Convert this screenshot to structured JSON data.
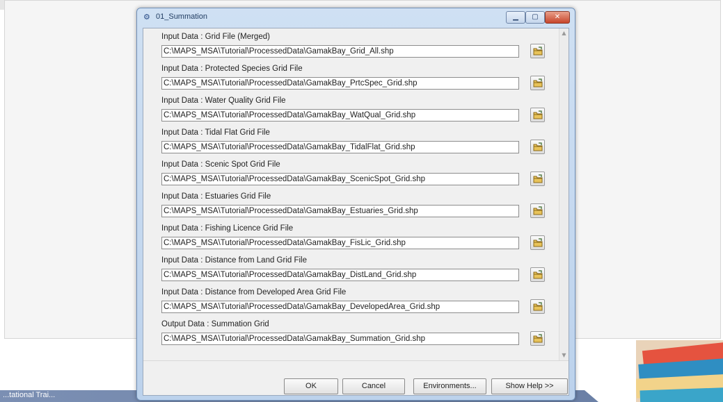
{
  "dialog": {
    "title": "01_Summation",
    "params": [
      {
        "label": "Input Data : Grid File (Merged)",
        "value": "C:\\MAPS_MSA\\Tutorial\\ProcessedData\\GamakBay_Grid_All.shp"
      },
      {
        "label": "Input Data : Protected Species Grid File",
        "value": "C:\\MAPS_MSA\\Tutorial\\ProcessedData\\GamakBay_PrtcSpec_Grid.shp"
      },
      {
        "label": "Input Data : Water Quality Grid File",
        "value": "C:\\MAPS_MSA\\Tutorial\\ProcessedData\\GamakBay_WatQual_Grid.shp"
      },
      {
        "label": "Input Data : Tidal Flat Grid File",
        "value": "C:\\MAPS_MSA\\Tutorial\\ProcessedData\\GamakBay_TidalFlat_Grid.shp"
      },
      {
        "label": "Input Data : Scenic Spot Grid File",
        "value": "C:\\MAPS_MSA\\Tutorial\\ProcessedData\\GamakBay_ScenicSpot_Grid.shp"
      },
      {
        "label": "Input Data : Estuaries Grid File",
        "value": "C:\\MAPS_MSA\\Tutorial\\ProcessedData\\GamakBay_Estuaries_Grid.shp"
      },
      {
        "label": "Input Data : Fishing Licence Grid File",
        "value": "C:\\MAPS_MSA\\Tutorial\\ProcessedData\\GamakBay_FisLic_Grid.shp"
      },
      {
        "label": "Input Data : Distance from Land Grid File",
        "value": "C:\\MAPS_MSA\\Tutorial\\ProcessedData\\GamakBay_DistLand_Grid.shp"
      },
      {
        "label": "Input Data : Distance from Developed Area Grid File",
        "value": "C:\\MAPS_MSA\\Tutorial\\ProcessedData\\GamakBay_DevelopedArea_Grid.shp"
      },
      {
        "label": "Output Data : Summation Grid",
        "value": "C:\\MAPS_MSA\\Tutorial\\ProcessedData\\GamakBay_Summation_Grid.shp"
      }
    ],
    "buttons": {
      "ok": "OK",
      "cancel": "Cancel",
      "environments": "Environments...",
      "show_help": "Show Help >>"
    }
  },
  "banner_text": "...tational Trai...",
  "colors": {
    "title_bar": "#cfe0f3",
    "close_button": "#c7452b",
    "banner": "#7b8fb3"
  }
}
